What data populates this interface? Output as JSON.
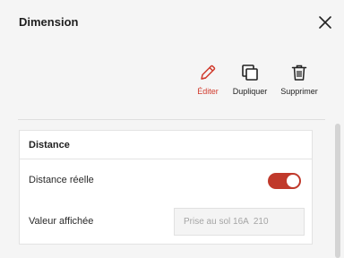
{
  "panel": {
    "title": "Dimension"
  },
  "icons": {
    "close": "close-icon",
    "edit": "pencil-icon",
    "duplicate": "duplicate-icon",
    "delete": "trash-icon"
  },
  "actions": [
    {
      "label": "Éditer",
      "icon": "pencil-icon",
      "color": "#d0392b"
    },
    {
      "label": "Dupliquer",
      "icon": "duplicate-icon"
    },
    {
      "label": "Supprimer",
      "icon": "trash-icon"
    }
  ],
  "section": {
    "title": "Distance",
    "real_distance": {
      "label": "Distance réelle",
      "enabled": true
    },
    "display_value": {
      "label": "Valeur affichée",
      "placeholder": "Prise au sol 16A  210"
    }
  },
  "colors": {
    "accent": "#c0392b",
    "edit_label": "#d0392b"
  }
}
